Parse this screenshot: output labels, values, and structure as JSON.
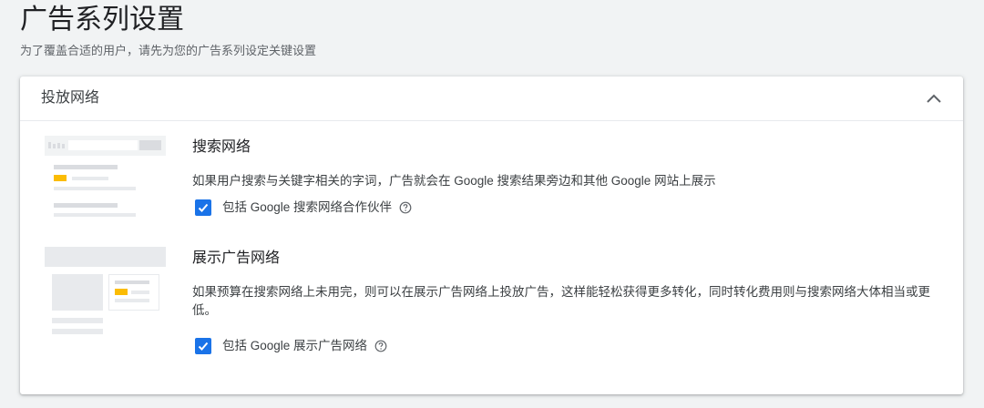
{
  "page": {
    "title": "广告系列设置",
    "subtitle": "为了覆盖合适的用户，请先为您的广告系列设定关键设置"
  },
  "card": {
    "header_title": "投放网络",
    "collapse_icon": "chevron-up-icon"
  },
  "sections": [
    {
      "title": "搜索网络",
      "description": "如果用户搜索与关键字相关的字词，广告就会在 Google 搜索结果旁边和其他 Google 网站上展示",
      "checkbox_label": "包括 Google 搜索网络合作伙伴",
      "checked": true
    },
    {
      "title": "展示广告网络",
      "description": "如果预算在搜索网络上未用完，则可以在展示广告网络上投放广告，这样能轻松获得更多转化，同时转化费用则与搜索网络大体相当或更低。",
      "checkbox_label": "包括 Google 展示广告网络",
      "checked": true
    }
  ],
  "colors": {
    "accent": "#1a73e8",
    "highlight": "#fbbc04",
    "background": "#f1f3f4"
  }
}
